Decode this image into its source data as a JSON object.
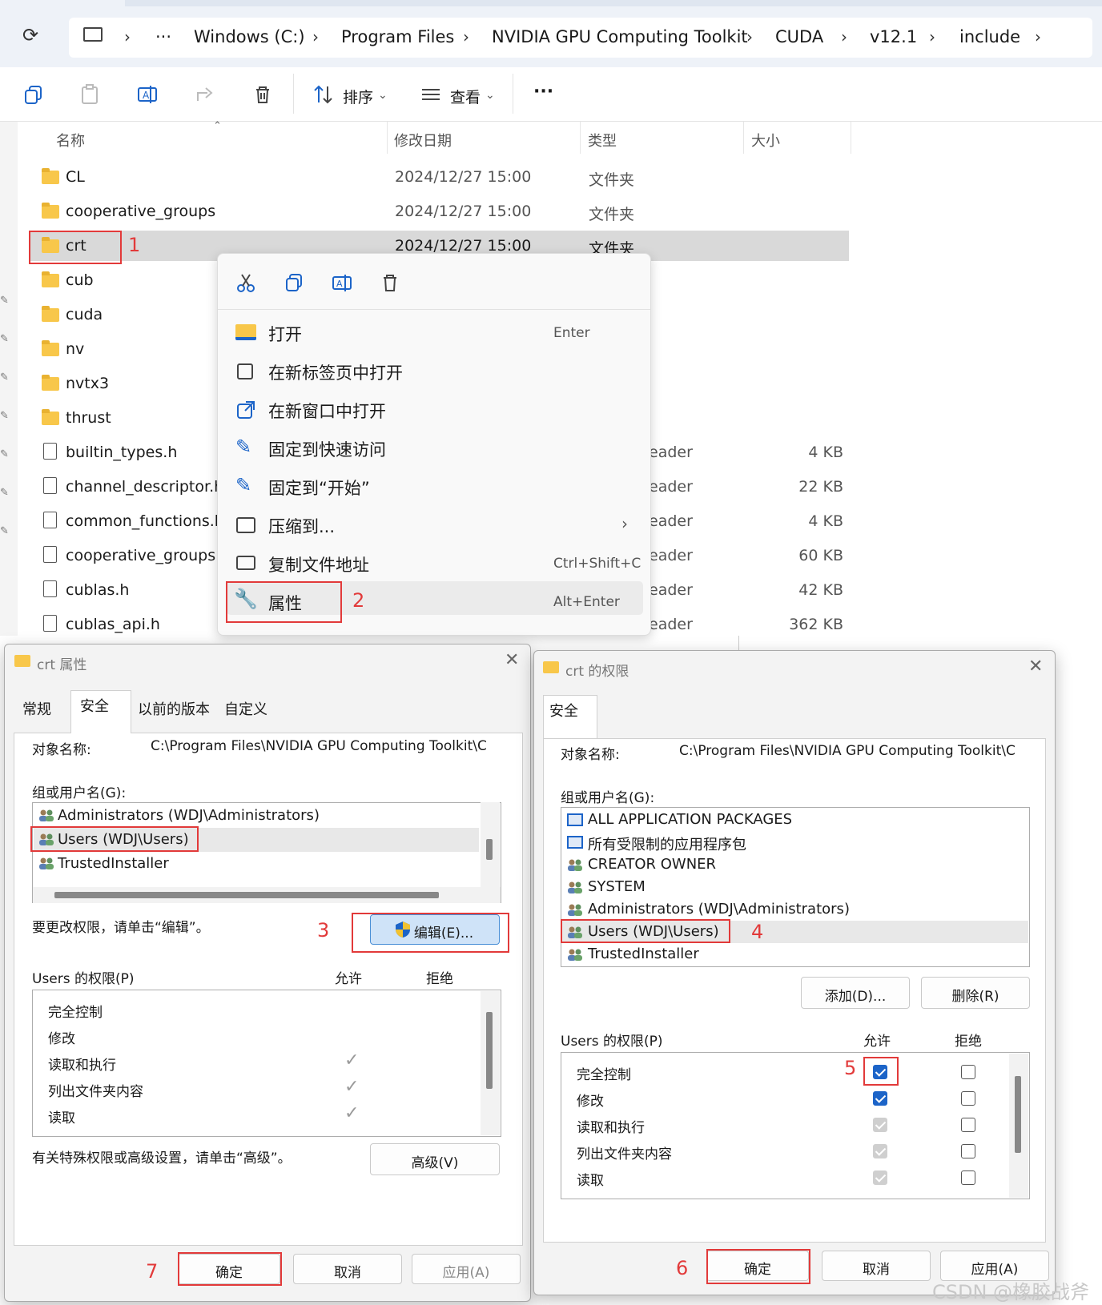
{
  "address_bar": {
    "crumbs": [
      "Windows (C:)",
      "Program Files",
      "NVIDIA GPU Computing Toolkit",
      "CUDA",
      "v12.1",
      "include"
    ],
    "more": "···"
  },
  "toolbar": {
    "sort_label": "排序",
    "view_label": "查看",
    "more": "···"
  },
  "columns": {
    "name": "名称",
    "date": "修改日期",
    "type": "类型",
    "size": "大小"
  },
  "files": [
    {
      "name": "CL",
      "date": "2024/12/27 15:00",
      "type": "文件夹",
      "size": ""
    },
    {
      "name": "cooperative_groups",
      "date": "2024/12/27 15:00",
      "type": "文件夹",
      "size": ""
    },
    {
      "name": "crt",
      "date": "2024/12/27 15:00",
      "type": "文件夹",
      "size": ""
    },
    {
      "name": "cub",
      "date": "",
      "type": "",
      "size": ""
    },
    {
      "name": "cuda",
      "date": "",
      "type": "",
      "size": ""
    },
    {
      "name": "nv",
      "date": "",
      "type": "",
      "size": ""
    },
    {
      "name": "nvtx3",
      "date": "",
      "type": "",
      "size": ""
    },
    {
      "name": "thrust",
      "date": "",
      "type": "",
      "size": ""
    },
    {
      "name": "builtin_types.h",
      "date": "",
      "type": "eader",
      "size": "4 KB"
    },
    {
      "name": "channel_descriptor.h",
      "date": "",
      "type": "eader",
      "size": "22 KB"
    },
    {
      "name": "common_functions.h",
      "date": "",
      "type": "eader",
      "size": "4 KB"
    },
    {
      "name": "cooperative_groups.h",
      "date": "",
      "type": "eader",
      "size": "60 KB"
    },
    {
      "name": "cublas.h",
      "date": "",
      "type": "eader",
      "size": "42 KB"
    },
    {
      "name": "cublas_api.h",
      "date": "",
      "type": "eader",
      "size": "362 KB"
    }
  ],
  "context_menu": {
    "items": [
      {
        "label": "打开",
        "shortcut": "Enter"
      },
      {
        "label": "在新标签页中打开",
        "shortcut": ""
      },
      {
        "label": "在新窗口中打开",
        "shortcut": ""
      },
      {
        "label": "固定到快速访问",
        "shortcut": ""
      },
      {
        "label": "固定到“开始”",
        "shortcut": ""
      },
      {
        "label": "压缩到...",
        "shortcut": ""
      },
      {
        "label": "复制文件地址",
        "shortcut": "Ctrl+Shift+C"
      },
      {
        "label": "属性",
        "shortcut": "Alt+Enter"
      }
    ]
  },
  "props_dialog": {
    "title": "crt 属性",
    "tabs": [
      "常规",
      "安全",
      "以前的版本",
      "自定义"
    ],
    "object_label": "对象名称:",
    "object_value": "C:\\Program Files\\NVIDIA GPU Computing Toolkit\\C",
    "group_label": "组或用户名(G):",
    "users": [
      "Administrators (WDJ\\Administrators)",
      "Users (WDJ\\Users)",
      "TrustedInstaller"
    ],
    "edit_hint": "要更改权限，请单击“编辑”。",
    "edit_button": "编辑(E)...",
    "perm_label": "Users 的权限(P)",
    "allow": "允许",
    "deny": "拒绝",
    "perms": [
      "完全控制",
      "修改",
      "读取和执行",
      "列出文件夹内容",
      "读取"
    ],
    "adv_hint": "有关特殊权限或高级设置，请单击“高级”。",
    "adv_button": "高级(V)",
    "ok": "确定",
    "cancel": "取消",
    "apply": "应用(A)"
  },
  "perm_dialog": {
    "title": "crt 的权限",
    "tab": "安全",
    "object_label": "对象名称:",
    "object_value": "C:\\Program Files\\NVIDIA GPU Computing Toolkit\\C",
    "group_label": "组或用户名(G):",
    "users": [
      "ALL APPLICATION PACKAGES",
      "所有受限制的应用程序包",
      "CREATOR OWNER",
      "SYSTEM",
      "Administrators (WDJ\\Administrators)",
      "Users (WDJ\\Users)",
      "TrustedInstaller"
    ],
    "add_button": "添加(D)...",
    "remove_button": "删除(R)",
    "perm_label": "Users 的权限(P)",
    "allow": "允许",
    "deny": "拒绝",
    "perms": [
      "完全控制",
      "修改",
      "读取和执行",
      "列出文件夹内容",
      "读取"
    ],
    "ok": "确定",
    "cancel": "取消",
    "apply": "应用(A)"
  },
  "annotations": [
    "1",
    "2",
    "3",
    "4",
    "5",
    "6",
    "7"
  ],
  "watermark": "CSDN @橡胶战斧",
  "colors": {
    "accent": "#1c64c8",
    "annotation": "#e23a3a",
    "folder": "#f8c74a"
  }
}
